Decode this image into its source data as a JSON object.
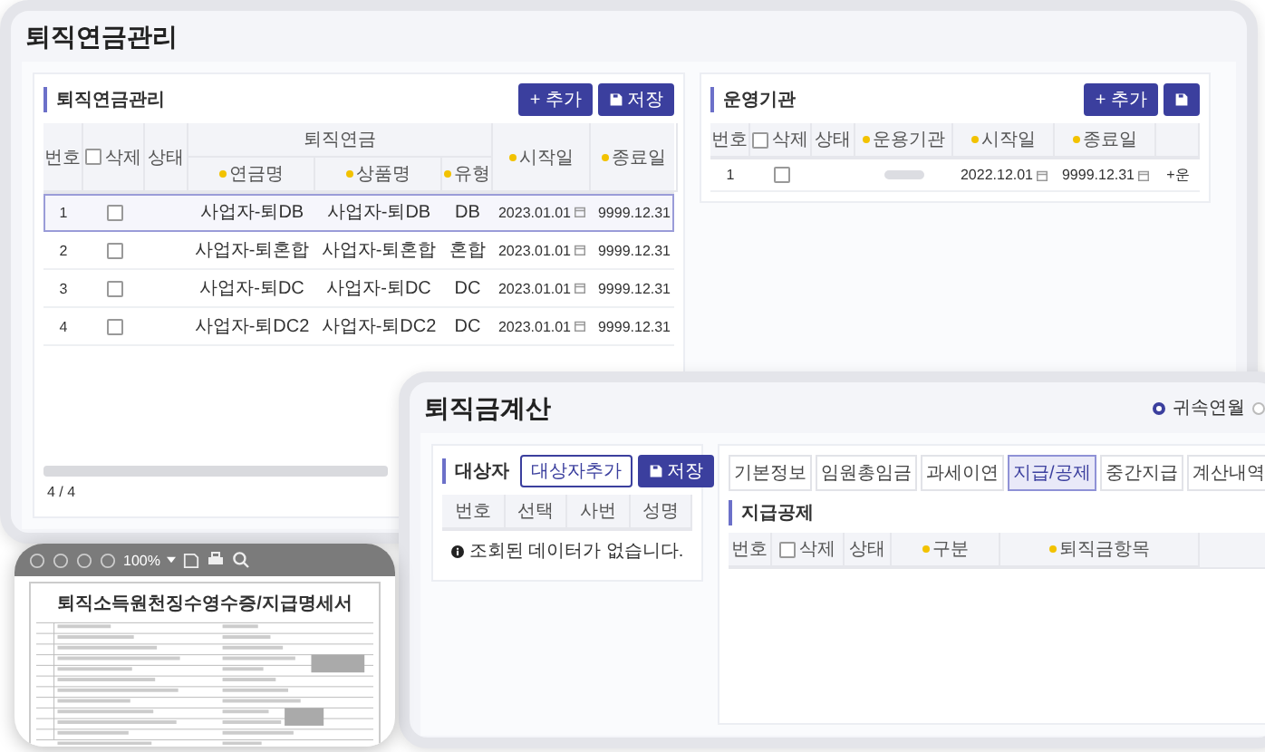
{
  "pension_window": {
    "title": "퇴직연금관리",
    "pension_panel": {
      "title": "퇴직연금관리",
      "buttons": [
        {
          "kind": "add",
          "label": "+ 추가"
        },
        {
          "kind": "save",
          "label": "저장"
        }
      ],
      "columns": [
        {
          "label": "번호",
          "kind": "text",
          "required": false
        },
        {
          "label": "삭제",
          "kind": "check",
          "checked": false,
          "required": false
        },
        {
          "label": "상태",
          "kind": "text",
          "required": false
        },
        {
          "group": "퇴직연금",
          "children": [
            {
              "label": "연금명",
              "required": true
            },
            {
              "label": "상품명",
              "required": true
            },
            {
              "label": "유형",
              "required": true
            }
          ]
        },
        {
          "label": "시작일",
          "kind": "text",
          "required": true
        },
        {
          "label": "종료일",
          "kind": "text",
          "required": true
        }
      ],
      "rows": [
        {
          "no": "1",
          "checked": false,
          "selected": true,
          "cells": [
            "사업자-퇴DB",
            "사업자-퇴DB",
            "DB"
          ],
          "start": "2023.01.01",
          "end": "9999.12.31"
        },
        {
          "no": "2",
          "checked": false,
          "selected": false,
          "cells": [
            "사업자-퇴혼합",
            "사업자-퇴혼합",
            "혼합"
          ],
          "start": "2023.01.01",
          "end": "9999.12.31"
        },
        {
          "no": "3",
          "checked": false,
          "selected": false,
          "cells": [
            "사업자-퇴DC",
            "사업자-퇴DC",
            "DC"
          ],
          "start": "2023.01.01",
          "end": "9999.12.31"
        },
        {
          "no": "4",
          "checked": false,
          "selected": false,
          "cells": [
            "사업자-퇴DC2",
            "사업자-퇴DC2",
            "DC"
          ],
          "start": "2023.01.01",
          "end": "9999.12.31"
        }
      ],
      "footer": "4 / 4"
    },
    "agency_panel": {
      "title": "운영기관",
      "buttons": [
        {
          "kind": "add",
          "label": "+ 추가"
        },
        {
          "kind": "save"
        }
      ],
      "columns": [
        {
          "label": "번호",
          "kind": "text",
          "required": false
        },
        {
          "label": "삭제",
          "kind": "check",
          "checked": false,
          "required": false
        },
        {
          "label": "상태",
          "kind": "text",
          "required": false
        },
        {
          "label": "운용기관",
          "kind": "text",
          "required": true
        },
        {
          "label": "시작일",
          "kind": "text",
          "required": true
        },
        {
          "label": "종료일",
          "kind": "text",
          "required": true
        }
      ],
      "rows": [
        {
          "no": "1",
          "checked": false,
          "start": "2022.12.01",
          "end": "9999.12.31",
          "column_7": "+운"
        }
      ]
    }
  },
  "calc_window": {
    "title": "퇴직금계산",
    "radios": [
      {
        "label": "귀속연월",
        "selected": true
      },
      {
        "selected": false
      }
    ],
    "target_panel": {
      "title": "대상자",
      "buttons": [
        {
          "kind": "outline",
          "label": "대상자추가"
        },
        {
          "kind": "save",
          "label": "저장"
        }
      ],
      "columns": [
        "번호",
        "선택",
        "사번",
        "성명"
      ],
      "empty_message": "조회된 데이터가 없습니다."
    },
    "detail_panel": {
      "tabs": [
        {
          "label": "기본정보",
          "selected": false
        },
        {
          "label": "임원총임금",
          "selected": false
        },
        {
          "label": "과세이연",
          "selected": false
        },
        {
          "label": "지급/공제",
          "selected": true
        },
        {
          "label": "중간지급",
          "selected": false
        },
        {
          "label": "계산내역",
          "selected": false
        }
      ],
      "section_title": "지급공제",
      "columns": [
        {
          "label": "번호",
          "kind": "text",
          "required": false
        },
        {
          "label": "삭제",
          "kind": "check",
          "checked": false,
          "required": false
        },
        {
          "label": "상태",
          "kind": "text",
          "required": false
        },
        {
          "label": "구분",
          "kind": "text",
          "required": true
        },
        {
          "label": "퇴직금항목",
          "kind": "text",
          "required": true
        }
      ]
    }
  },
  "viewer_window": {
    "zoom": "100%",
    "document_title": "퇴직소득원천징수영수증/지급명세서"
  }
}
